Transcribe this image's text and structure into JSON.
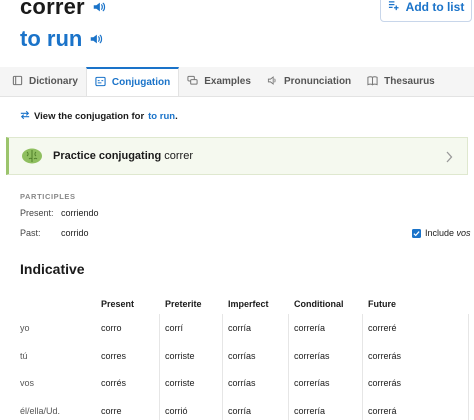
{
  "entry": {
    "headword": "correr",
    "translation": "to run",
    "add_to_list": "Add to list"
  },
  "tabs": [
    {
      "label": "Dictionary",
      "icon": "book-icon"
    },
    {
      "label": "Conjugation",
      "icon": "conjugation-icon"
    },
    {
      "label": "Examples",
      "icon": "speech-bubbles-icon"
    },
    {
      "label": "Pronunciation",
      "icon": "speaker-icon"
    },
    {
      "label": "Thesaurus",
      "icon": "thesaurus-icon"
    }
  ],
  "active_tab": "Conjugation",
  "view_conjugation": {
    "prefix": "View the conjugation for",
    "link": "to run",
    "suffix": "."
  },
  "practice": {
    "bold": "Practice conjugating",
    "verb": "correr"
  },
  "participles": {
    "heading": "PARTICIPLES",
    "present_label": "Present:",
    "present_value": "corriendo",
    "past_label": "Past:",
    "past_value": "corrido"
  },
  "include_vos": {
    "label_plain": "Include",
    "label_italic": "vos",
    "checked": true
  },
  "indicative": {
    "title": "Indicative",
    "columns": [
      "Present",
      "Preterite",
      "Imperfect",
      "Conditional",
      "Future"
    ],
    "rows": [
      {
        "pronoun": "yo",
        "forms": [
          "corro",
          "corrí",
          "corría",
          "correría",
          "correré"
        ]
      },
      {
        "pronoun": "tú",
        "forms": [
          "corres",
          "corriste",
          "corrías",
          "correrías",
          "correrás"
        ]
      },
      {
        "pronoun": "vos",
        "forms": [
          "corrés",
          "corriste",
          "corrías",
          "correrías",
          "correrás"
        ]
      },
      {
        "pronoun": "él/ella/Ud.",
        "forms": [
          "corre",
          "corrió",
          "corría",
          "correría",
          "correrá"
        ]
      }
    ]
  },
  "colors": {
    "accent": "#1a73c9",
    "practice_bg": "#f5f9ef",
    "practice_border": "#9bc46c"
  }
}
